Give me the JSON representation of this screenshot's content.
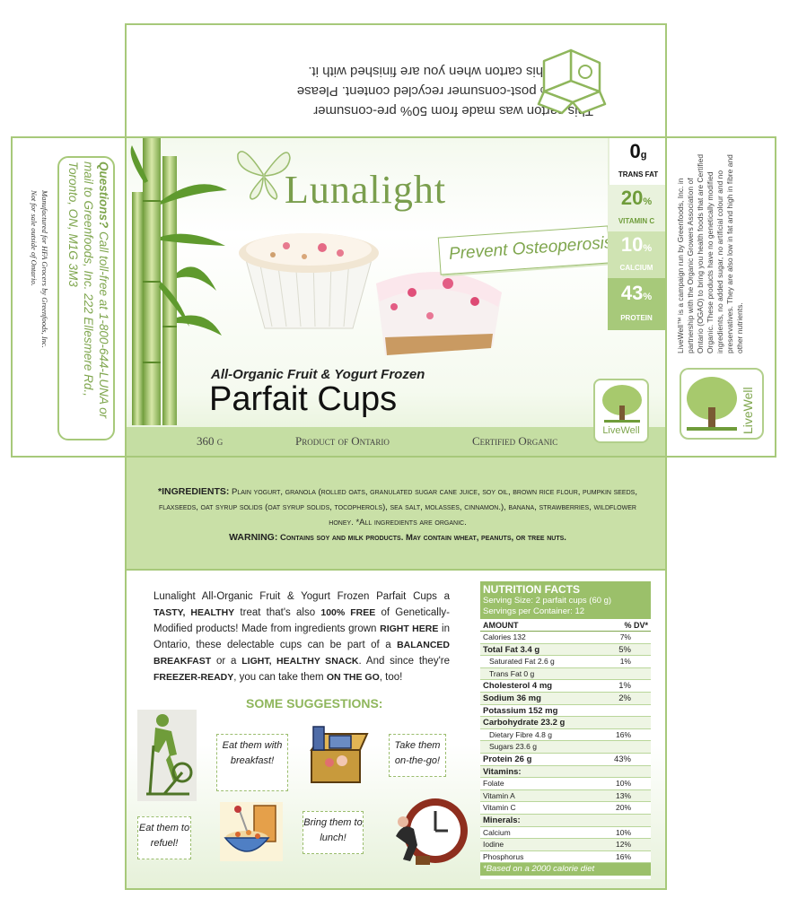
{
  "top_flap": {
    "recycle_line1": "This carton was made from 50% pre-consumer",
    "recycle_line2": "and 40% post-consumer recycled content. Please",
    "recycle_line3": "recycle this carton when you are finished with it."
  },
  "left_side": {
    "questions_label": "Questions?",
    "questions_text": "Call toll-free at 1-800-644-LUNA or mail to Greenfoods, Inc. 222 Ellesmere Rd., Toronto, ON, M1G 3M3",
    "manufactured_line1": "Manufactured for HFA Grocers by Greenfoods, Inc.",
    "manufactured_line2": "Not for sale outside of Ontario."
  },
  "front": {
    "brand": "Lunalight",
    "slogan": "Prevent Osteoperosis",
    "subtitle": "All-Organic Fruit & Yogurt Frozen",
    "title": "Parfait Cups",
    "weight": "360 g",
    "origin": "Product of Ontario",
    "certified": "Certified Organic",
    "livewell": "LiveWell",
    "badges": [
      {
        "value": "0",
        "unit": "g",
        "label": "TRANS FAT"
      },
      {
        "value": "20",
        "unit": "%",
        "label": "VITAMIN C"
      },
      {
        "value": "10",
        "unit": "%",
        "label": "CALCIUM"
      },
      {
        "value": "43",
        "unit": "%",
        "label": "PROTEIN"
      }
    ]
  },
  "right_side": {
    "text": "LiveWell™ is a campaign run by Greenfoods, Inc. in partnership with the Organic Growers Association of Ontario (OGAO) to bring you health foods that are Certified Organic. These products have no genetically modified ingredients, no added sugar, no artificial colour and no preservatives. They are also low in fat and high in fibre and other nutrients.",
    "livewell": "LiveWell"
  },
  "ingredients": {
    "label": "*INGREDIENTS:",
    "text": "Plain yogurt, granola (rolled oats, granulated sugar cane juice, soy oil, brown rice flour, pumpkin seeds, flaxseeds, oat syrup solids (oat syrup solids, tocopherols), sea salt, molasses, cinnamon.), banana, strawberries, wildflower honey. *All ingredients are organic.",
    "warning_label": "WARNING:",
    "warning_text": "Contains soy and milk products. May contain wheat, peanuts, or tree nuts."
  },
  "back": {
    "description": [
      {
        "t": "Lunalight All-Organic Fruit & Yogurt Frozen Parfait Cups a ",
        "b": false
      },
      {
        "t": "TASTY, HEALTHY",
        "b": true
      },
      {
        "t": " treat that's also ",
        "b": false
      },
      {
        "t": "100% FREE",
        "b": true
      },
      {
        "t": " of Genetically-Modified products! Made from ingredients grown ",
        "b": false
      },
      {
        "t": "RIGHT HERE",
        "b": true
      },
      {
        "t": " in Ontario, these delectable cups can be part of a ",
        "b": false
      },
      {
        "t": "BALANCED BREAKFAST",
        "b": true
      },
      {
        "t": " or a ",
        "b": false
      },
      {
        "t": "LIGHT, HEALTHY SNACK",
        "b": true
      },
      {
        "t": ". And since they're ",
        "b": false
      },
      {
        "t": "FREEZER-READY",
        "b": true
      },
      {
        "t": ",  you can take them ",
        "b": false
      },
      {
        "t": "ON THE GO",
        "b": true
      },
      {
        "t": ", too!",
        "b": false
      }
    ],
    "suggestions_title": "SOME SUGGESTIONS:",
    "suggestions": [
      "Eat them with breakfast!",
      "Take them on-the-go!",
      "Eat them to refuel!",
      "Bring them to lunch!"
    ]
  },
  "nutrition": {
    "title": "NUTRITION FACTS",
    "serving_size": "Serving Size: 2 parfait cups (60 g)",
    "servings": "Servings per Container: 12",
    "col_amount": "AMOUNT",
    "col_dv": "% DV*",
    "rows": [
      {
        "name": "Calories 132",
        "dv": "7%",
        "bold": false,
        "indent": false
      },
      {
        "name": "Total Fat 3.4 g",
        "dv": "5%",
        "bold": true,
        "indent": false
      },
      {
        "name": "Saturated Fat 2.6 g",
        "dv": "1%",
        "bold": false,
        "indent": true
      },
      {
        "name": "Trans Fat 0 g",
        "dv": "",
        "bold": false,
        "indent": true
      },
      {
        "name": "Cholesterol 4 mg",
        "dv": "1%",
        "bold": true,
        "indent": false
      },
      {
        "name": "Sodium 36 mg",
        "dv": "2%",
        "bold": true,
        "indent": false
      },
      {
        "name": "Potassium 152 mg",
        "dv": "",
        "bold": true,
        "indent": false
      },
      {
        "name": "Carbohydrate 23.2 g",
        "dv": "",
        "bold": true,
        "indent": false
      },
      {
        "name": "Dietary Fibre 4.8 g",
        "dv": "16%",
        "bold": false,
        "indent": true
      },
      {
        "name": "Sugars 23.6 g",
        "dv": "",
        "bold": false,
        "indent": true
      },
      {
        "name": "Protein 26 g",
        "dv": "43%",
        "bold": true,
        "indent": false
      },
      {
        "name": "Vitamins:",
        "dv": "",
        "bold": true,
        "indent": false
      },
      {
        "name": "Folate",
        "dv": "10%",
        "bold": false,
        "indent": false
      },
      {
        "name": "Vitamin A",
        "dv": "13%",
        "bold": false,
        "indent": false
      },
      {
        "name": "Vitamin C",
        "dv": "20%",
        "bold": false,
        "indent": false
      },
      {
        "name": "Minerals:",
        "dv": "",
        "bold": true,
        "indent": false
      },
      {
        "name": "Calcium",
        "dv": "10%",
        "bold": false,
        "indent": false
      },
      {
        "name": "Iodine",
        "dv": "12%",
        "bold": false,
        "indent": false
      },
      {
        "name": "Phosphorus",
        "dv": "16%",
        "bold": false,
        "indent": false
      }
    ],
    "footnote": "*Based on a 2000 calorie diet"
  },
  "colors": {
    "green_dark": "#7fa64e",
    "green_light": "#c9e0a7",
    "green_mid": "#9bc06a"
  }
}
